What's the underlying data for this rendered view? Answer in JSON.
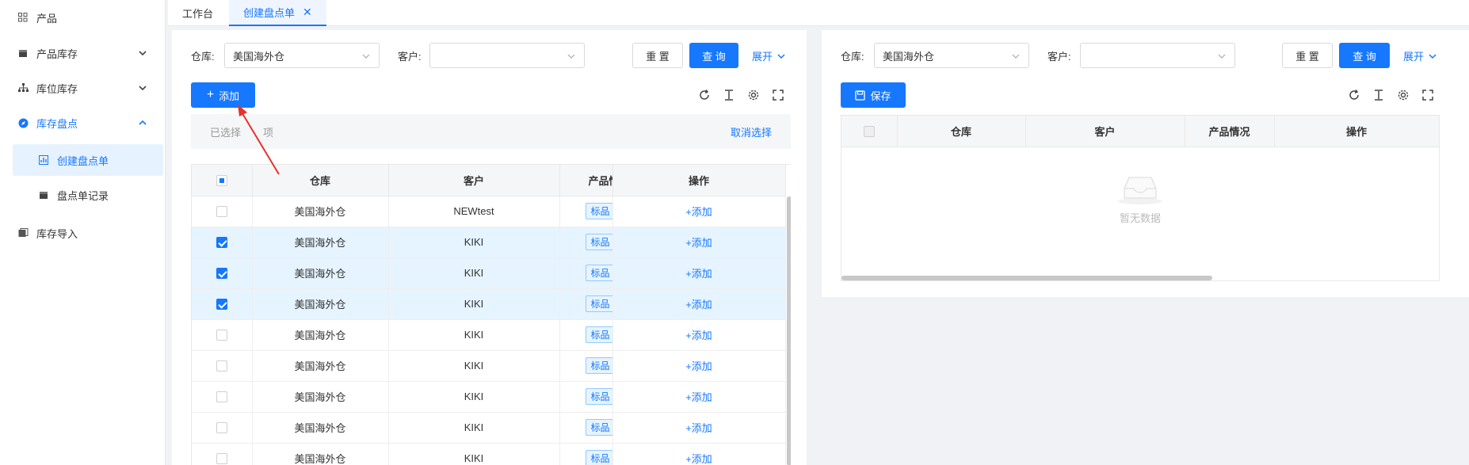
{
  "sidebar": {
    "items": [
      {
        "label": "产品",
        "icon": "grid-icon",
        "has_chevron": false
      },
      {
        "label": "产品库存",
        "icon": "box-icon",
        "has_chevron": true,
        "chevron": "down"
      },
      {
        "label": "库位库存",
        "icon": "hierarchy-icon",
        "has_chevron": true,
        "chevron": "down"
      },
      {
        "label": "库存盘点",
        "icon": "compass-icon",
        "has_chevron": true,
        "chevron": "up",
        "active": true
      }
    ],
    "sub_items": [
      {
        "label": "创建盘点单",
        "icon": "chart-icon",
        "active": true
      },
      {
        "label": "盘点单记录",
        "icon": "box-icon",
        "active": false
      }
    ],
    "last_item": {
      "label": "库存导入",
      "icon": "import-icon"
    }
  },
  "tabs": [
    {
      "label": "工作台",
      "active": false
    },
    {
      "label": "创建盘点单",
      "active": true,
      "closable": true
    }
  ],
  "left": {
    "warehouse_label": "仓库:",
    "warehouse_value": "美国海外仓",
    "customer_label": "客户:",
    "customer_value": "",
    "reset_label": "重 置",
    "query_label": "查 询",
    "expand_label": "展开",
    "add_label": "添加",
    "selected_text": "已选择",
    "selected_suffix": "项",
    "cancel_select": "取消选择",
    "columns": [
      "仓库",
      "客户",
      "产品情况",
      "操作"
    ],
    "rows": [
      {
        "warehouse": "美国海外仓",
        "customer": "NEWtest",
        "tag": "标品",
        "action": "+添加",
        "checked": false
      },
      {
        "warehouse": "美国海外仓",
        "customer": "KIKI",
        "tag": "标品",
        "action": "+添加",
        "checked": true
      },
      {
        "warehouse": "美国海外仓",
        "customer": "KIKI",
        "tag": "标品",
        "action": "+添加",
        "checked": true
      },
      {
        "warehouse": "美国海外仓",
        "customer": "KIKI",
        "tag": "标品",
        "action": "+添加",
        "checked": true
      },
      {
        "warehouse": "美国海外仓",
        "customer": "KIKI",
        "tag": "标品",
        "action": "+添加",
        "checked": false
      },
      {
        "warehouse": "美国海外仓",
        "customer": "KIKI",
        "tag": "标品",
        "action": "+添加",
        "checked": false
      },
      {
        "warehouse": "美国海外仓",
        "customer": "KIKI",
        "tag": "标品",
        "action": "+添加",
        "checked": false
      },
      {
        "warehouse": "美国海外仓",
        "customer": "KIKI",
        "tag": "标品",
        "action": "+添加",
        "checked": false
      },
      {
        "warehouse": "美国海外仓",
        "customer": "KIKI",
        "tag": "标品",
        "action": "+添加",
        "checked": false
      }
    ]
  },
  "right": {
    "warehouse_label": "仓库:",
    "warehouse_value": "美国海外仓",
    "customer_label": "客户:",
    "customer_value": "",
    "reset_label": "重 置",
    "query_label": "查 询",
    "expand_label": "展开",
    "save_label": "保存",
    "columns": [
      "仓库",
      "客户",
      "产品情况",
      "操作"
    ],
    "empty_text": "暂无数据"
  },
  "colors": {
    "primary": "#1677ff",
    "selected_row": "#e6f4ff",
    "annotation_arrow": "#e8312a"
  }
}
